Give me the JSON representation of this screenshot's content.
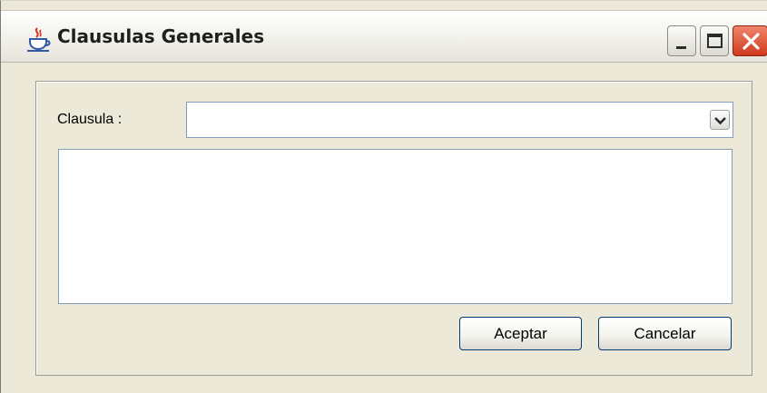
{
  "window": {
    "title": "Clausulas Generales",
    "icons": {
      "app": "java-cup-icon",
      "minimize": "minimize-icon",
      "maximize": "maximize-icon",
      "close": "close-icon"
    },
    "colors": {
      "close_button": "#D2452A",
      "frame": "#ECE9D8",
      "field_border": "#7F9DB9"
    }
  },
  "form": {
    "clausula_label": "Clausula :",
    "clausula_value": "",
    "text_content": ""
  },
  "buttons": {
    "accept_label": "Aceptar",
    "cancel_label": "Cancelar"
  }
}
